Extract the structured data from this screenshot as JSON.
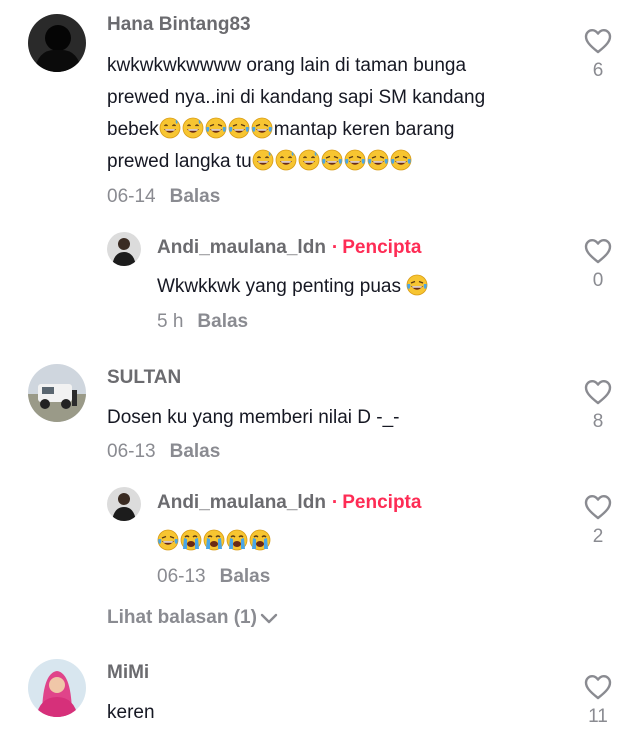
{
  "comments": [
    {
      "author": "Hana Bintang83",
      "lines": [
        "kwkwkwkwwww orang lain di taman bunga",
        "prewed nya..ini di kandang sapi SM kandang",
        "bebek",
        "mantap keren barang",
        "prewed langka tu"
      ],
      "date": "06-14",
      "reply_label": "Balas",
      "likes": "6"
    },
    {
      "author": "Andi_maulana_ldn",
      "badge": "Pencipta",
      "badge_sep": "·",
      "text": "Wkwkkwk yang penting puas",
      "date": "5 h",
      "reply_label": "Balas",
      "likes": "0"
    },
    {
      "author": "SULTAN",
      "text": "Dosen ku yang memberi nilai D -_-",
      "date": "06-13",
      "reply_label": "Balas",
      "likes": "8"
    },
    {
      "author": "Andi_maulana_ldn",
      "badge": "Pencipta",
      "badge_sep": "·",
      "date": "06-13",
      "reply_label": "Balas",
      "likes": "2"
    },
    {
      "author": "MiMi",
      "text": "keren",
      "likes": "11"
    }
  ],
  "view_replies": "Lihat balasan (1)",
  "icons": {
    "like": "heart-outline-icon",
    "expand": "chevron-down-icon",
    "laugh": "tears-of-joy-emoji",
    "sweat": "grinning-sweat-emoji",
    "cry": "loudly-crying-emoji"
  },
  "colors": {
    "creator": "#fe2c55",
    "muted": "#8a8b91",
    "text": "#161823"
  }
}
